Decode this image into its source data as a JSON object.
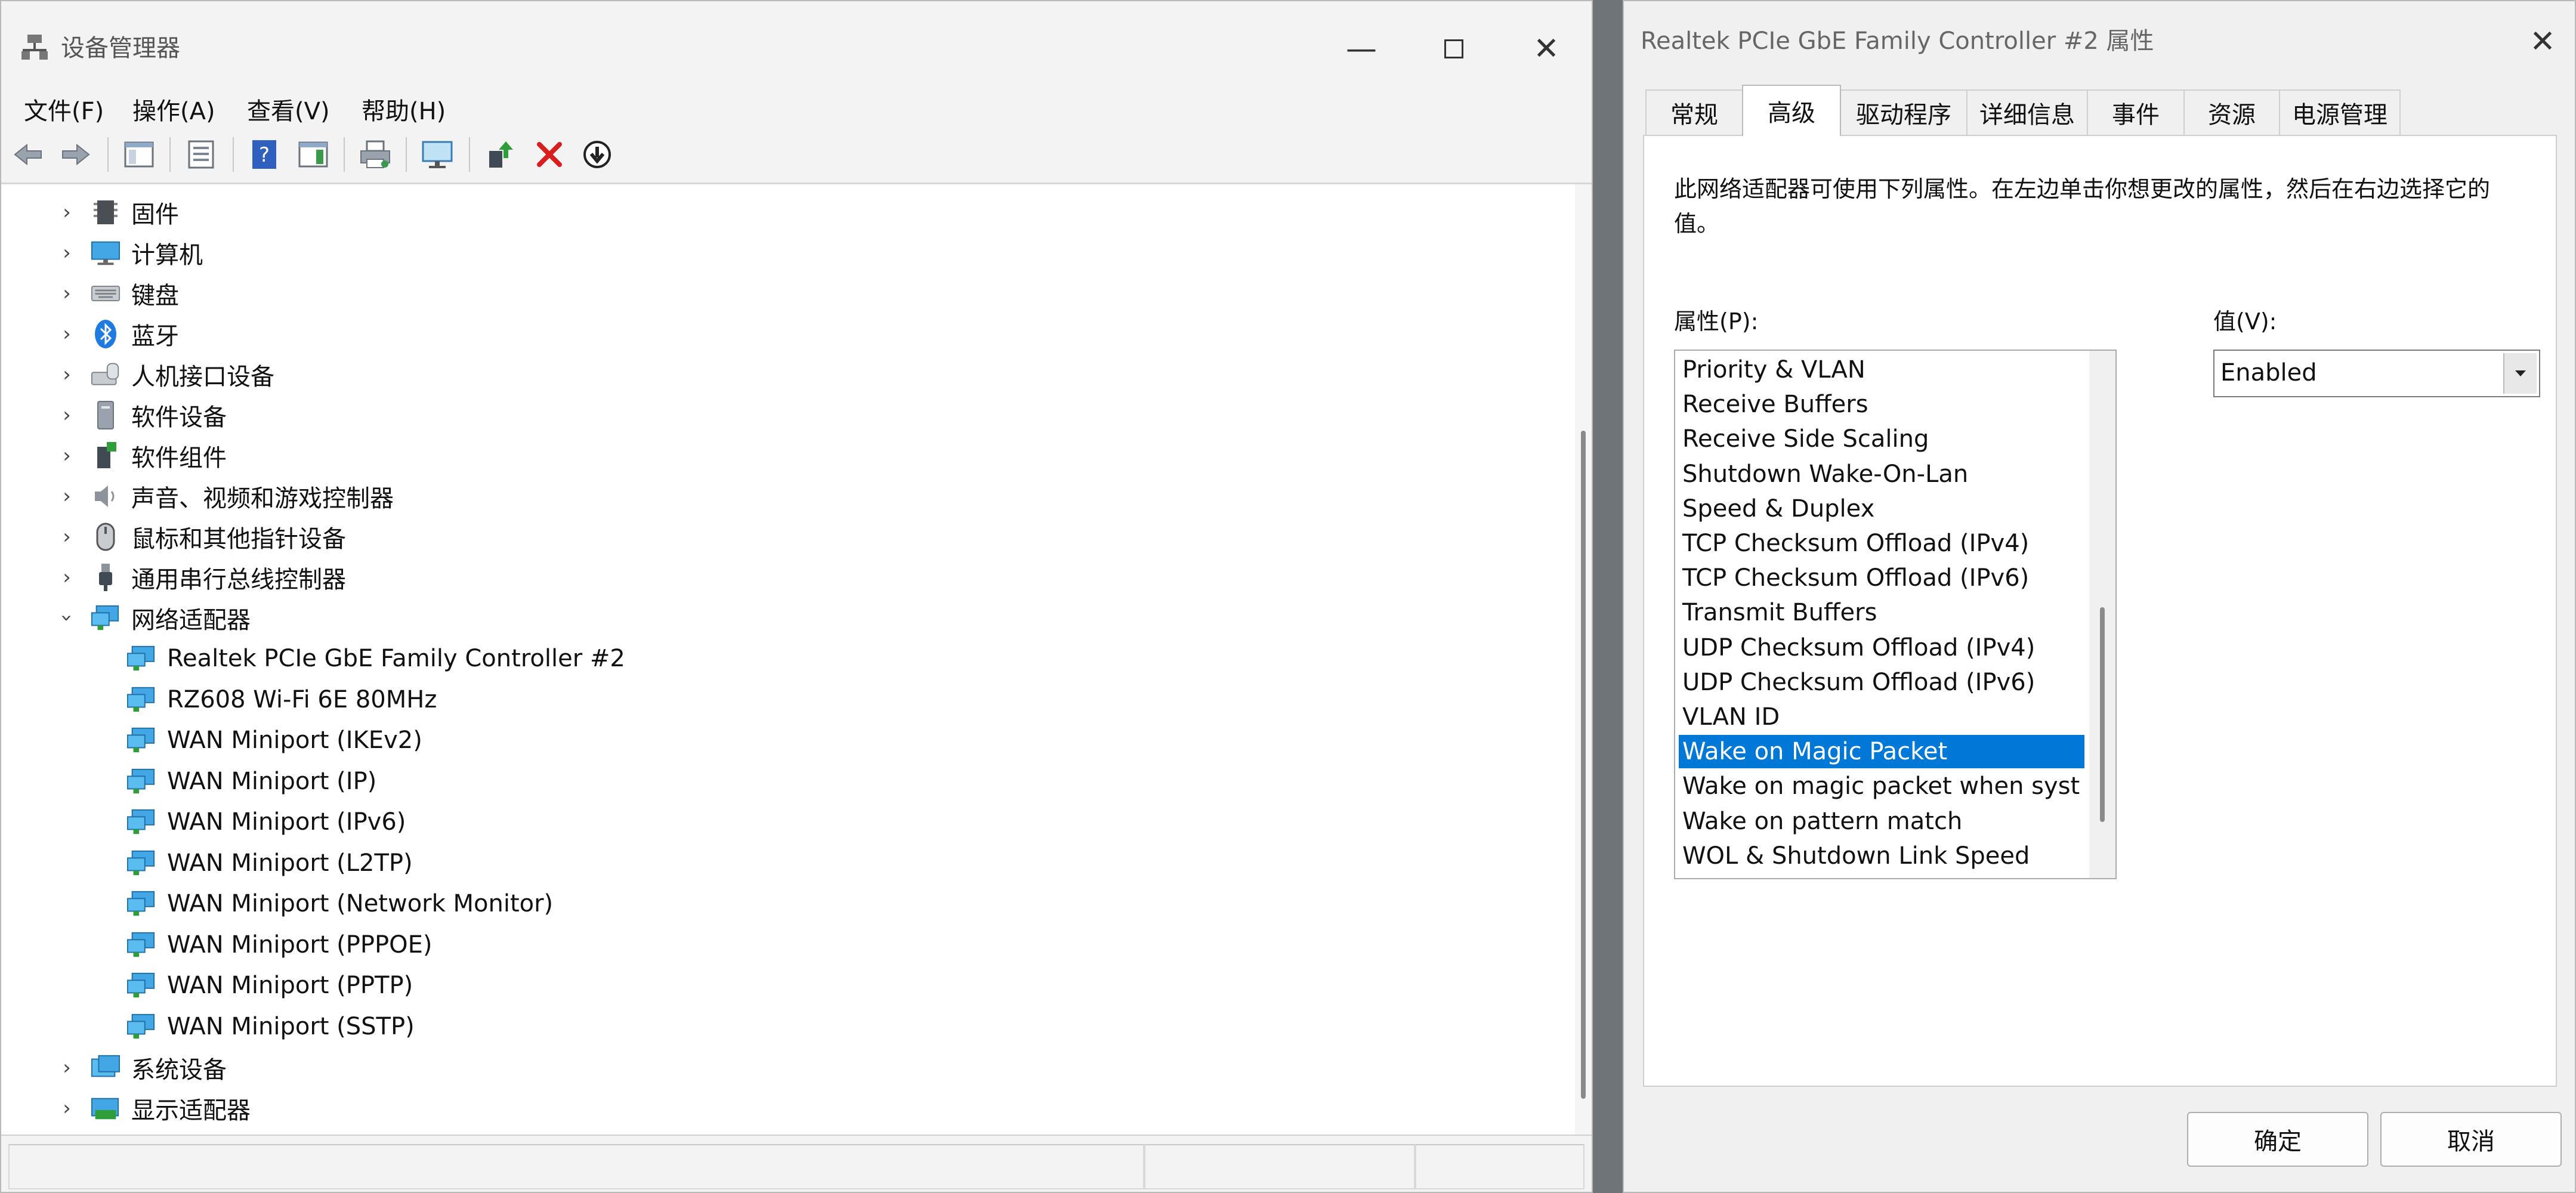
{
  "device_manager": {
    "title": "设备管理器",
    "menu": [
      "文件(F)",
      "操作(A)",
      "查看(V)",
      "帮助(H)"
    ],
    "toolbar_icons": [
      "back-arrow-icon",
      "forward-arrow-icon",
      "show-hide-console-tree-icon",
      "properties-icon",
      "help-icon",
      "action-pane-icon",
      "print-icon",
      "scan-hardware-icon",
      "update-driver-icon",
      "disable-device-icon",
      "uninstall-device-icon"
    ],
    "tree_categories_top": [
      "固件",
      "计算机",
      "键盘",
      "蓝牙",
      "人机接口设备",
      "软件设备",
      "软件组件",
      "声音、视频和游戏控制器",
      "鼠标和其他指针设备",
      "通用串行总线控制器"
    ],
    "expanded_category": "网络适配器",
    "network_adapters": [
      "Realtek PCIe GbE Family Controller #2",
      "RZ608 Wi-Fi 6E 80MHz",
      "WAN Miniport (IKEv2)",
      "WAN Miniport (IP)",
      "WAN Miniport (IPv6)",
      "WAN Miniport (L2TP)",
      "WAN Miniport (Network Monitor)",
      "WAN Miniport (PPPOE)",
      "WAN Miniport (PPTP)",
      "WAN Miniport (SSTP)"
    ],
    "tree_categories_bottom": [
      "系统设备",
      "显示适配器"
    ]
  },
  "properties_dialog": {
    "title": "Realtek PCIe GbE Family Controller #2 属性",
    "tabs": [
      "常规",
      "高级",
      "驱动程序",
      "详细信息",
      "事件",
      "资源",
      "电源管理"
    ],
    "active_tab": "高级",
    "description": "此网络适配器可使用下列属性。在左边单击你想更改的属性，然后在右边选择它的值。",
    "property_label": "属性(P):",
    "value_label": "值(V):",
    "properties": [
      "Priority & VLAN",
      "Receive Buffers",
      "Receive Side Scaling",
      "Shutdown Wake-On-Lan",
      "Speed & Duplex",
      "TCP Checksum Offload (IPv4)",
      "TCP Checksum Offload (IPv6)",
      "Transmit Buffers",
      "UDP Checksum Offload (IPv4)",
      "UDP Checksum Offload (IPv6)",
      "VLAN ID",
      "Wake on Magic Packet",
      "Wake on magic packet when syst",
      "Wake on pattern match",
      "WOL & Shutdown Link Speed"
    ],
    "selected_property": "Wake on Magic Packet",
    "value": "Enabled",
    "ok_label": "确定",
    "cancel_label": "取消"
  },
  "colors": {
    "selection": "#0078d7",
    "window_bg": "#f3f3f3",
    "desktop": "#6f7479"
  }
}
